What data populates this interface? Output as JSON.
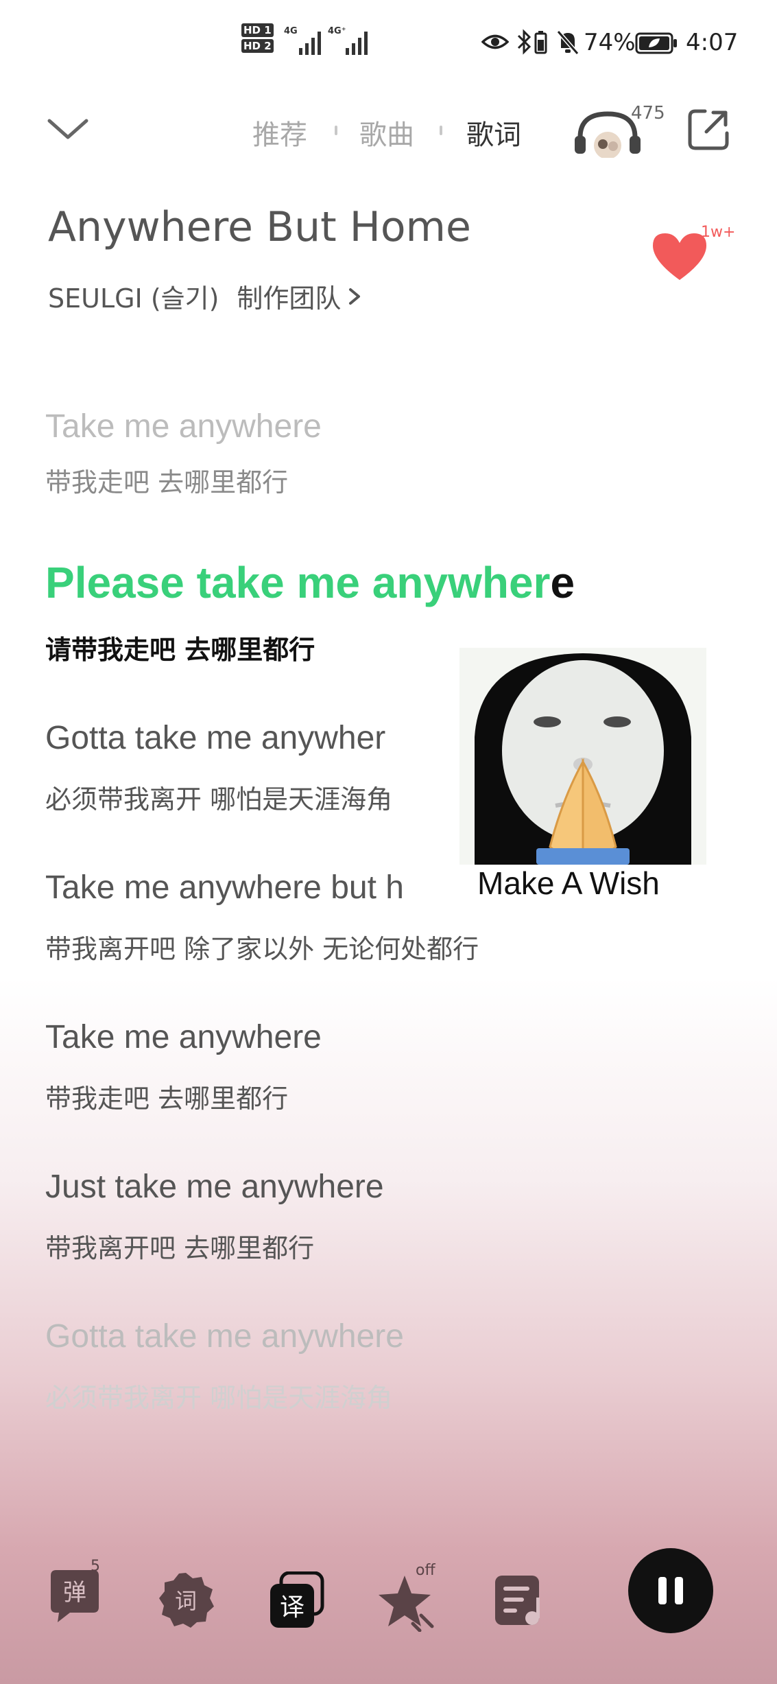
{
  "status_bar": {
    "hd1": "HD 1",
    "hd2": "HD 2",
    "net1": "4G",
    "net2": "4G⁺",
    "battery": "74%",
    "time": "4:07"
  },
  "header": {
    "tabs": [
      "推荐",
      "歌曲",
      "歌词"
    ],
    "listeners": "475"
  },
  "song": {
    "title": "Anywhere But Home",
    "artist": "SEULGI (슬기)",
    "team_link": "制作团队",
    "likes": "1w+"
  },
  "lyrics": [
    {
      "en": "Take me anywhere",
      "cn": "带我走吧 去哪里都行",
      "state": "faded"
    },
    {
      "en_sung": "Please take me anywher",
      "en_rest": "e",
      "cn": "请带我走吧 去哪里都行",
      "state": "active"
    },
    {
      "en": "Gotta take me anywher",
      "cn": "必须带我离开 哪怕是天涯海角",
      "state": "normal"
    },
    {
      "en": "Take me anywhere but h",
      "cn": "带我离开吧 除了家以外 无论何处都行",
      "state": "normal"
    },
    {
      "en": "Take me anywhere",
      "cn": "带我走吧 去哪里都行",
      "state": "normal"
    },
    {
      "en": "Just take me anywhere",
      "cn": "带我离开吧 去哪里都行",
      "state": "normal"
    },
    {
      "en": "Gotta take me anywhere",
      "cn": "必须带我离开 哪怕是天涯海角",
      "state": "faded"
    }
  ],
  "sticker": {
    "caption": "Make A Wish"
  },
  "toolbar": {
    "danmaku": "弹",
    "danmaku_count": "5",
    "lyrics_mode": "词",
    "translate": "译",
    "effect_badge": "off"
  },
  "colors": {
    "accent_green": "#39d07a",
    "like_red": "#f25a5a"
  }
}
